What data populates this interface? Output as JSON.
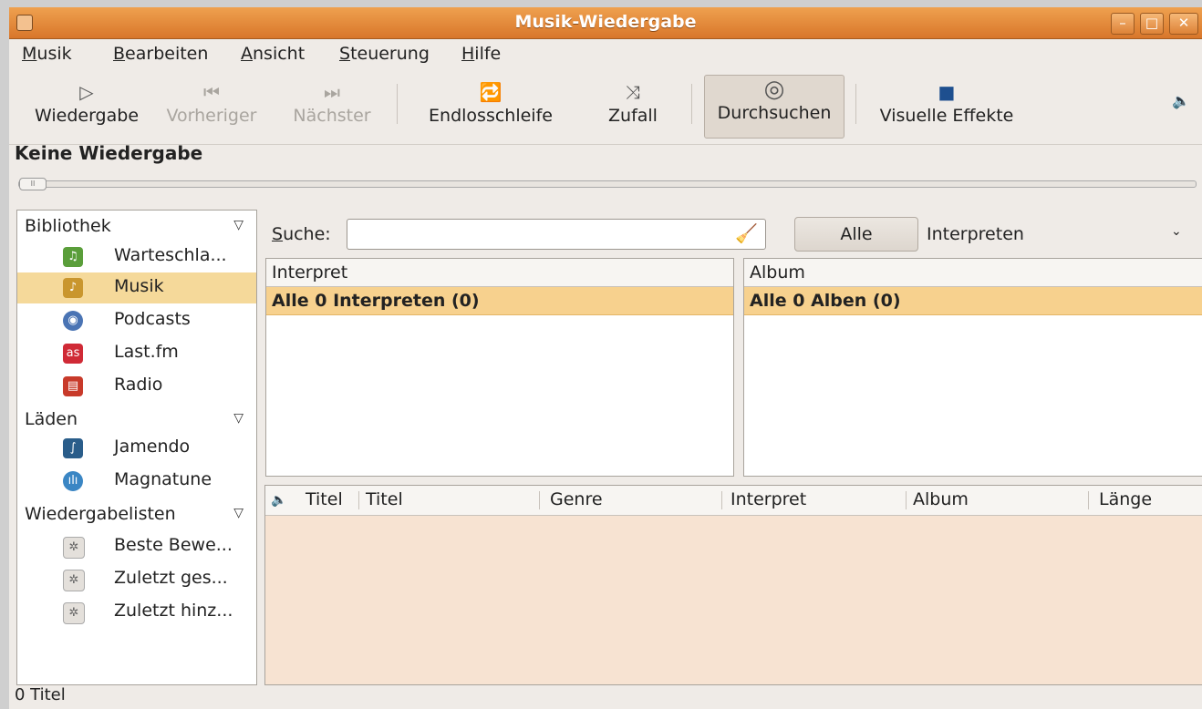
{
  "window": {
    "title": "Musik-Wiedergabe",
    "buttons": {
      "minimize": "–",
      "maximize": "□",
      "close": "✕"
    }
  },
  "menubar": {
    "items": [
      {
        "mnemonic": "M",
        "rest": "usik"
      },
      {
        "mnemonic": "B",
        "rest": "earbeiten"
      },
      {
        "mnemonic": "A",
        "rest": "nsicht"
      },
      {
        "mnemonic": "S",
        "rest": "teuerung"
      },
      {
        "mnemonic": "H",
        "rest": "ilfe"
      }
    ]
  },
  "toolbar": {
    "play": {
      "icon": "play-icon",
      "glyph": "▷",
      "label": "Wiedergabe"
    },
    "previous": {
      "icon": "previous-icon",
      "glyph": "⏮",
      "label": "Vorheriger"
    },
    "next": {
      "icon": "next-icon",
      "glyph": "⏭",
      "label": "Nächster"
    },
    "repeat": {
      "icon": "repeat-icon",
      "glyph": "🔁",
      "label": "Endlosschleife"
    },
    "shuffle": {
      "icon": "shuffle-icon",
      "glyph": "⤨",
      "label": "Zufall"
    },
    "browse": {
      "icon": "disc-icon",
      "glyph": "◎",
      "label": "Durchsuchen"
    },
    "visual": {
      "icon": "visual-effects-icon",
      "glyph": "■",
      "label": "Visuelle Effekte"
    },
    "volume": {
      "icon": "volume-icon",
      "glyph": "🔈"
    }
  },
  "now_playing": "Keine Wiedergabe",
  "sidebar": {
    "groups": [
      {
        "label": "Bibliothek"
      },
      {
        "label": "Läden"
      },
      {
        "label": "Wiedergabelisten"
      }
    ],
    "items": [
      {
        "label": "Warteschla...",
        "icon": "queue-icon",
        "color": "#5a9e3a"
      },
      {
        "label": "Musik",
        "icon": "music-icon",
        "color": "#c9962e"
      },
      {
        "label": "Podcasts",
        "icon": "podcast-icon",
        "color": "#4a74b4"
      },
      {
        "label": "Last.fm",
        "icon": "lastfm-icon",
        "color": "#d02a36"
      },
      {
        "label": "Radio",
        "icon": "radio-icon",
        "color": "#c83a2a"
      },
      {
        "label": "Jamendo",
        "icon": "jamendo-icon",
        "color": "#2a5d8a"
      },
      {
        "label": "Magnatune",
        "icon": "magnatune-icon",
        "color": "#3a86c4"
      },
      {
        "label": "Beste Bewe...",
        "icon": "gear-icon",
        "color": "#8a8a8a"
      },
      {
        "label": "Zuletzt ges...",
        "icon": "gear-icon",
        "color": "#8a8a8a"
      },
      {
        "label": "Zuletzt hinz...",
        "icon": "gear-icon",
        "color": "#8a8a8a"
      }
    ]
  },
  "search": {
    "label_mnemonic": "S",
    "label_rest": "uche:",
    "value": "",
    "all_button": "Alle",
    "filter": "Interpreten"
  },
  "artist_pane": {
    "header": "Interpret",
    "row": "Alle 0 Interpreten (0)"
  },
  "album_pane": {
    "header": "Album",
    "row": "Alle 0 Alben (0)"
  },
  "tracks": {
    "columns": [
      "Titel",
      "Titel",
      "Genre",
      "Interpret",
      "Album",
      "Länge"
    ]
  },
  "status": "0 Titel"
}
